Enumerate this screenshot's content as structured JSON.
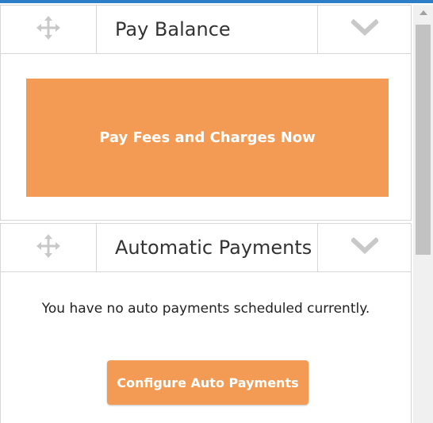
{
  "pay_widget": {
    "title": "Pay Balance",
    "drag_icon": "move-arrows-icon",
    "toggle_icon": "chevron-down-icon",
    "pay_button_label": "Pay Fees and Charges Now"
  },
  "auto_widget": {
    "title": "Automatic Payments",
    "drag_icon": "move-arrows-icon",
    "toggle_icon": "chevron-down-icon",
    "message": "You have no auto payments scheduled currently.",
    "configure_button_label": "Configure Auto Payments"
  },
  "colors": {
    "accent_orange": "#f39b55",
    "top_bar_blue": "#2c7fc6",
    "border_gray": "#d6d6d6",
    "icon_gray": "#c8c8c8"
  },
  "scrollbar": {
    "up_icon": "scroll-up-arrow-icon"
  }
}
